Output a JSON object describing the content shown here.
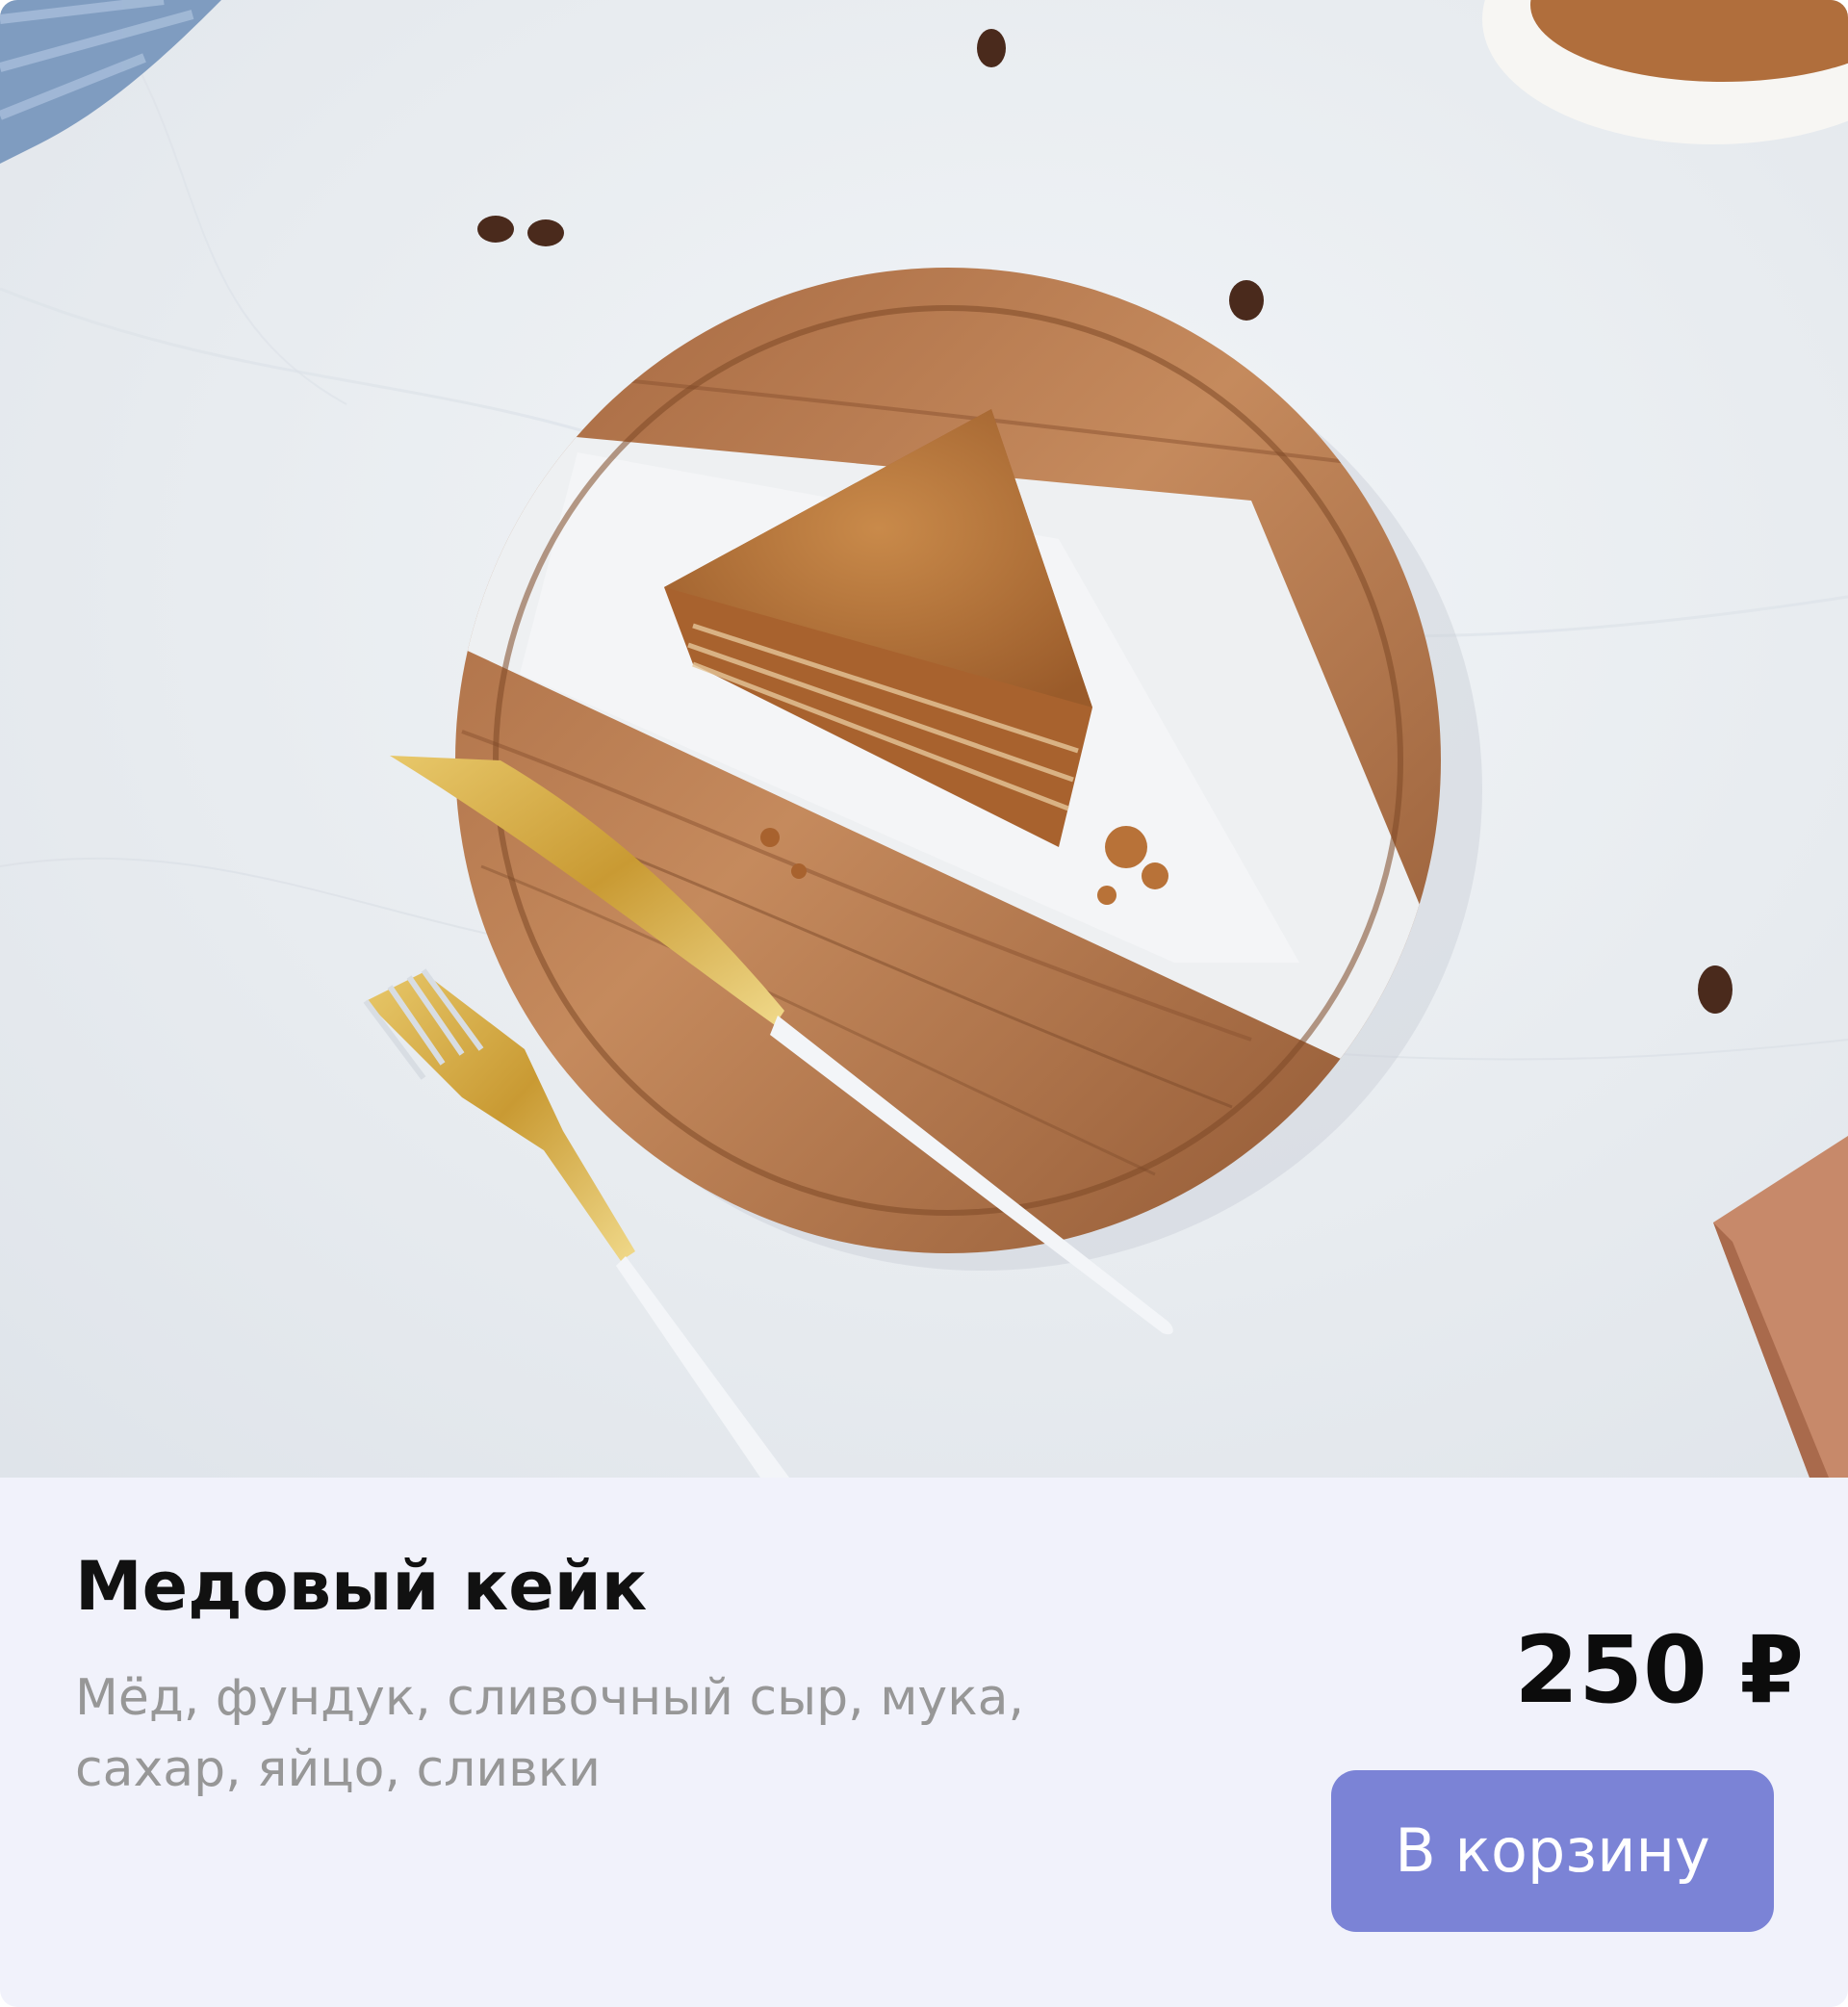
{
  "product": {
    "title": "Медовый кейк",
    "description": "Мёд, фундук, сливочный сыр, мука, сахар, яйцо, сливки",
    "price": "250 ₽",
    "add_to_cart_label": "В корзину"
  },
  "colors": {
    "card_background": "#f1f2fb",
    "button_background": "#7b83d6",
    "button_text": "#ffffff",
    "title_text": "#111111",
    "description_text": "#979797"
  },
  "icons": {
    "photo": "honey-cake-photo"
  }
}
